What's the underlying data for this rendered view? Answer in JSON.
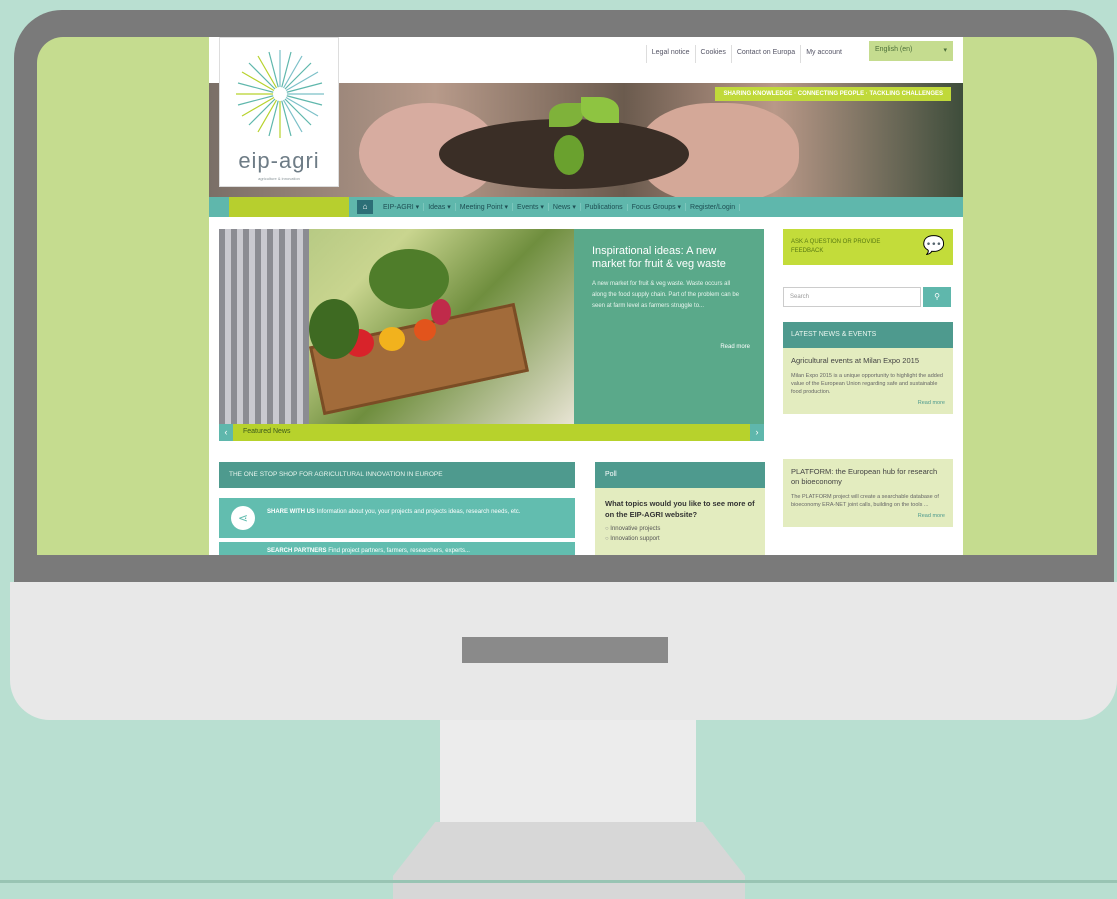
{
  "site": {
    "logo_text": "eip-agri",
    "logo_subtitle": "agriculture & innovation",
    "top_links": [
      "Legal notice",
      "Cookies",
      "Contact on Europa",
      "My account"
    ],
    "language": "English (en)",
    "tagline": "SHARING KNOWLEDGE · CONNECTING PEOPLE · TACKLING CHALLENGES",
    "nav": [
      "EIP-AGRI ▾",
      "Ideas ▾",
      "Meeting Point ▾",
      "Events ▾",
      "News ▾",
      "Publications",
      "Focus Groups ▾",
      "Register/Login"
    ],
    "slide": {
      "title": "Inspirational ideas: A new market for fruit & veg waste",
      "body": "A new market for fruit & veg waste. Waste occurs all along the food supply chain. Part of the problem can be seen at farm level as farmers struggle to...",
      "read_more": "Read more",
      "bar_label": "Featured News"
    },
    "one_stop": "THE ONE STOP SHOP FOR AGRICULTURAL INNOVATION IN EUROPE",
    "share": {
      "label": "SHARE WITH US",
      "text": "Information about you, your projects and projects ideas, research needs, etc."
    },
    "search_partners": {
      "label": "SEARCH PARTNERS",
      "text": "Find project partners, farmers, researchers, experts..."
    },
    "poll": {
      "heading": "Poll",
      "question": "What topics would you like to see more of on the EIP-AGRI website?",
      "options": [
        "Innovative projects",
        "Innovation support"
      ]
    },
    "ask": "ASK A QUESTION OR PROVIDE FEEDBACK",
    "search_placeholder": "Search",
    "news_heading": "LATEST NEWS & EVENTS",
    "news": [
      {
        "title": "Agricultural events at Milan Expo 2015",
        "body": "Milan Expo 2015 is a unique opportunity to highlight the added value of the European Union regarding safe and sustainable food production.",
        "more": "Read more"
      },
      {
        "title": "PLATFORM: the European hub for research on bioeconomy",
        "body": "The PLATFORM project will create a searchable database of bioeconomy ERA-NET joint calls, building on the tools ...",
        "more": "Read more"
      }
    ]
  },
  "colors": {
    "background": "#b9dfd1",
    "screen_green": "#c5dc8f",
    "nav_teal": "#5fb7ac",
    "lime": "#b7d22c",
    "dark_teal": "#4e9a8e"
  }
}
